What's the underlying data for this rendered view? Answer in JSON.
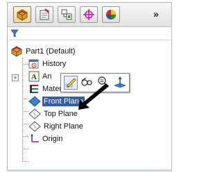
{
  "toolbar": {
    "tabs": [
      {
        "name": "featuremanager-tab",
        "icon": "part-icon",
        "active": true
      },
      {
        "name": "propertymanager-tab",
        "icon": "property-icon",
        "active": false
      },
      {
        "name": "configurationmanager-tab",
        "icon": "configuration-icon",
        "active": false
      },
      {
        "name": "dimxpert-tab",
        "icon": "crosshair-icon",
        "active": false
      },
      {
        "name": "display-manager-tab",
        "icon": "color-sphere-icon",
        "active": false
      }
    ],
    "more_label": "»"
  },
  "filter": {
    "icon": "filter-icon"
  },
  "tree": {
    "part": "Part1 (Default)",
    "history": "History",
    "annotations": "An",
    "material": "Material <not specified>",
    "front_plane": "Front Plane",
    "top_plane": "Top Plane",
    "right_plane": "Right Plane",
    "origin": "Origin"
  },
  "context_toolbar": {
    "items": [
      "edit-sketch-icon",
      "hide-show-icon",
      "zoom-to-selection-icon",
      "normal-to-icon"
    ]
  },
  "colors": {
    "selection": "#2f5faa",
    "plane_blue": "#3d7fd1",
    "origin_blue": "#1f4fa0"
  }
}
